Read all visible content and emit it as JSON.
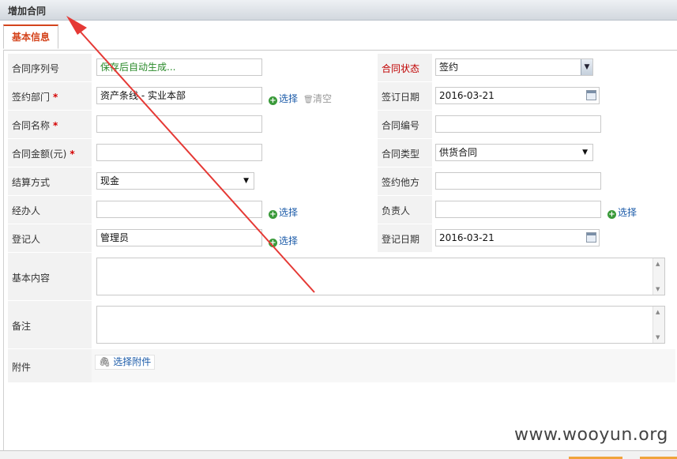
{
  "window": {
    "title": "增加合同"
  },
  "tabs": [
    {
      "label": "基本信息"
    }
  ],
  "form": {
    "serial": {
      "label": "合同序列号",
      "placeholder": "保存后自动生成..."
    },
    "status": {
      "label": "合同状态",
      "value": "签约"
    },
    "department": {
      "label": "签约部门",
      "required_mark": "*",
      "value": "资产条线 - 实业本部",
      "select": "选择",
      "clear": "清空"
    },
    "sign_date": {
      "label": "签订日期",
      "value": "2016-03-21"
    },
    "name": {
      "label": "合同名称",
      "required_mark": "*",
      "value": ""
    },
    "number": {
      "label": "合同编号",
      "value": ""
    },
    "amount": {
      "label": "合同金额(元)",
      "required_mark": "*",
      "value": ""
    },
    "type": {
      "label": "合同类型",
      "value": "供货合同"
    },
    "settlement": {
      "label": "结算方式",
      "value": "现金"
    },
    "other_party": {
      "label": "签约他方",
      "value": ""
    },
    "handler": {
      "label": "经办人",
      "value": "",
      "select": "选择"
    },
    "responsible": {
      "label": "负责人",
      "value": "",
      "select": "选择"
    },
    "registrar": {
      "label": "登记人",
      "value": "管理员",
      "select": "选择"
    },
    "register_date": {
      "label": "登记日期",
      "value": "2016-03-21"
    },
    "content": {
      "label": "基本内容",
      "value": ""
    },
    "remark": {
      "label": "备注",
      "value": ""
    },
    "attachment": {
      "label": "附件",
      "select": "选择附件"
    }
  },
  "watermark": "www.wooyun.org",
  "annotation": {
    "color": "#e53935"
  }
}
